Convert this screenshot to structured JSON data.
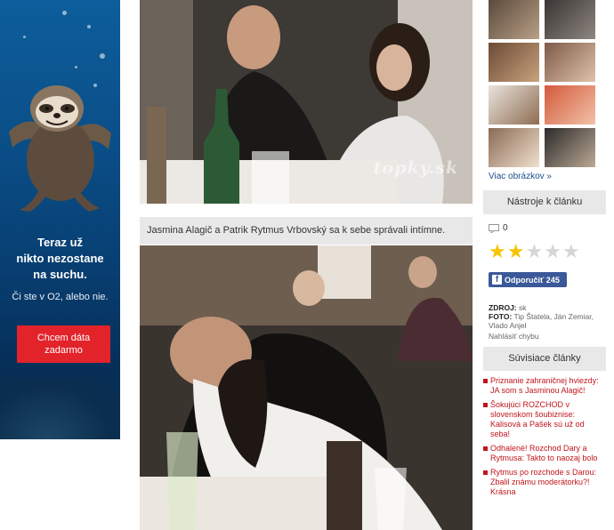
{
  "ad": {
    "headline": "Teraz už\nnikto nezostane\nna suchu.",
    "subline": "Či ste v O2, alebo nie.",
    "cta": "Chcem dáta\nzadarmo",
    "brand_color": "#e3232a"
  },
  "article": {
    "photo1_watermark": "topky.sk",
    "caption": "Jasmina Alagič a Patrik Rytmus Vrbovský sa k sebe správali intímne."
  },
  "sidebar": {
    "more_images": "Viac obrázkov »",
    "tools_title": "Nástroje k článku",
    "comment_count": "0",
    "rating": {
      "filled": 2,
      "total": 5,
      "filled_color": "#f5c400",
      "empty_color": "#d6d6d6"
    },
    "fb_button": "Odporučiť 245",
    "source_label": "ZDROJ:",
    "source_value": "sk",
    "photo_label": "FOTO:",
    "photo_value": "Tip Štatela, Ján Zemiar, Vlado Anjel",
    "report": "Nahlásiť chybu",
    "related_title": "Súvisiace články",
    "related": [
      "Priznanie zahraničnej hviezdy: JA som s Jasminou Alagič!",
      "Šokujúci ROZCHOD v slovenskom šoubiznise: Kalisová a Pašek sú už od seba!",
      "Odhalené! Rozchod Dary a Rytmusa: Takto to naozaj bolo",
      "Rytmus po rozchode s Darou: Zbalil známu moderátorku?! Krásna"
    ]
  }
}
